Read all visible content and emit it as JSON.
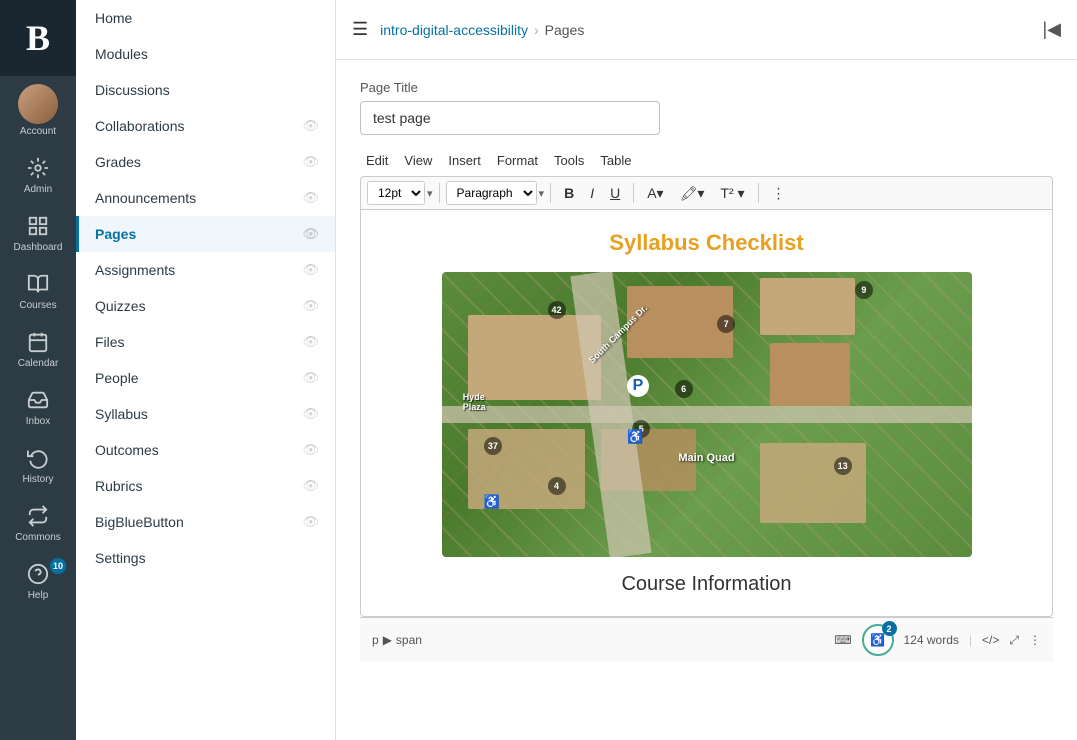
{
  "app": {
    "logo": "B",
    "brand_color": "#2d3b45"
  },
  "left_nav": {
    "items": [
      {
        "id": "account",
        "label": "Account",
        "icon": "👤",
        "type": "avatar"
      },
      {
        "id": "admin",
        "label": "Admin",
        "icon": "⚙"
      },
      {
        "id": "dashboard",
        "label": "Dashboard",
        "icon": "⊞"
      },
      {
        "id": "courses",
        "label": "Courses",
        "icon": "📖"
      },
      {
        "id": "calendar",
        "label": "Calendar",
        "icon": "📅"
      },
      {
        "id": "inbox",
        "label": "Inbox",
        "icon": "✉"
      },
      {
        "id": "history",
        "label": "History",
        "icon": "🕐"
      },
      {
        "id": "commons",
        "label": "Commons",
        "icon": "↻"
      },
      {
        "id": "help",
        "label": "Help",
        "icon": "?",
        "badge": "10"
      }
    ]
  },
  "top_bar": {
    "course_link": "intro-digital-accessibility",
    "separator": "›",
    "current_page": "Pages"
  },
  "course_sidebar": {
    "items": [
      {
        "id": "home",
        "label": "Home",
        "has_eye": false,
        "active": false
      },
      {
        "id": "modules",
        "label": "Modules",
        "has_eye": false,
        "active": false
      },
      {
        "id": "discussions",
        "label": "Discussions",
        "has_eye": false,
        "active": false
      },
      {
        "id": "collaborations",
        "label": "Collaborations",
        "has_eye": true,
        "active": false
      },
      {
        "id": "grades",
        "label": "Grades",
        "has_eye": true,
        "active": false
      },
      {
        "id": "announcements",
        "label": "Announcements",
        "has_eye": true,
        "active": false
      },
      {
        "id": "pages",
        "label": "Pages",
        "has_eye": true,
        "active": true
      },
      {
        "id": "assignments",
        "label": "Assignments",
        "has_eye": true,
        "active": false
      },
      {
        "id": "quizzes",
        "label": "Quizzes",
        "has_eye": true,
        "active": false
      },
      {
        "id": "files",
        "label": "Files",
        "has_eye": true,
        "active": false
      },
      {
        "id": "people",
        "label": "People",
        "has_eye": true,
        "active": false
      },
      {
        "id": "syllabus",
        "label": "Syllabus",
        "has_eye": true,
        "active": false
      },
      {
        "id": "outcomes",
        "label": "Outcomes",
        "has_eye": true,
        "active": false
      },
      {
        "id": "rubrics",
        "label": "Rubrics",
        "has_eye": true,
        "active": false
      },
      {
        "id": "bigbluebutton",
        "label": "BigBlueButton",
        "has_eye": true,
        "active": false
      },
      {
        "id": "settings",
        "label": "Settings",
        "has_eye": false,
        "active": false
      }
    ]
  },
  "editor": {
    "page_title_label": "Page Title",
    "page_title_value": "test page",
    "menubar": [
      "Edit",
      "View",
      "Insert",
      "Format",
      "Tools",
      "Table"
    ],
    "font_size": "12pt",
    "paragraph": "Paragraph",
    "content_title": "Syllabus Checklist",
    "course_info_heading": "Course Information"
  },
  "status_bar": {
    "path": "p",
    "arrow": "▶",
    "span": "span",
    "a11y_badge": "2",
    "word_count": "124 words",
    "code_btn": "</>",
    "expand_label": "⤢"
  },
  "map": {
    "labels": [
      "42",
      "9",
      "7",
      "6",
      "5",
      "4",
      "37",
      "13"
    ],
    "text_labels": [
      "South Campus Dr.",
      "Hyde Plaza",
      "Main Quad"
    ]
  }
}
